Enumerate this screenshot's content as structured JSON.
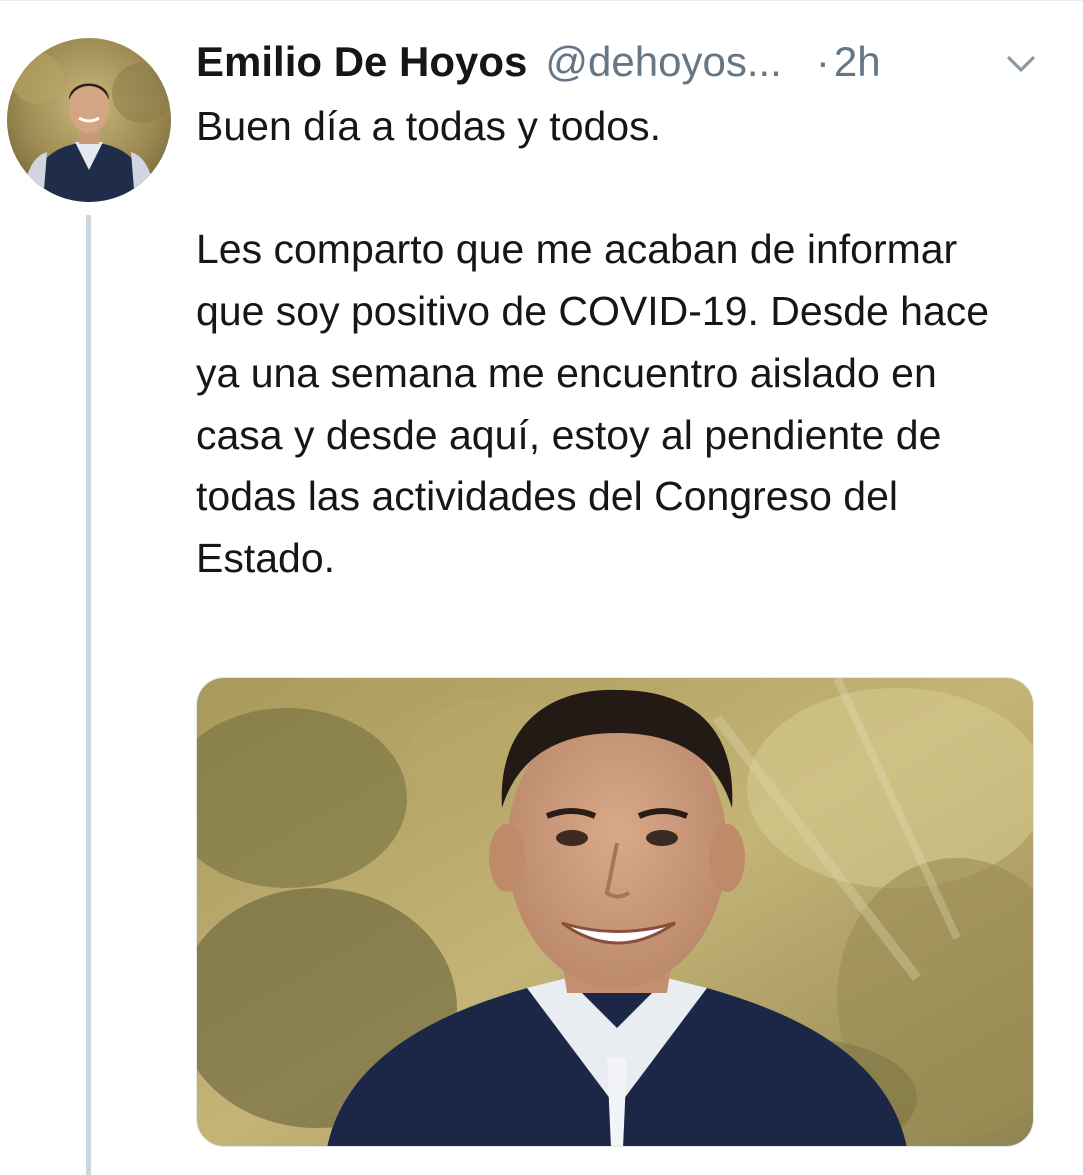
{
  "tweet": {
    "author": {
      "display_name": "Emilio De Hoyos",
      "handle": "@dehoyos..."
    },
    "separator": "·",
    "timestamp": "2h",
    "text_paragraphs": [
      "Buen día a todas y todos.",
      "Les comparto que me acaban de informar que soy positivo de COVID-19. Desde hace ya una semana me encuentro aislado en casa y desde aquí, estoy al pendiente de todas las actividades del Congreso del Estado."
    ],
    "icons": {
      "avatar": "profile-photo",
      "menu": "chevron-down-icon",
      "media": "photo"
    },
    "colors": {
      "text": "#14171a",
      "secondary": "#657786",
      "thread_line": "#ccd6dd"
    }
  }
}
